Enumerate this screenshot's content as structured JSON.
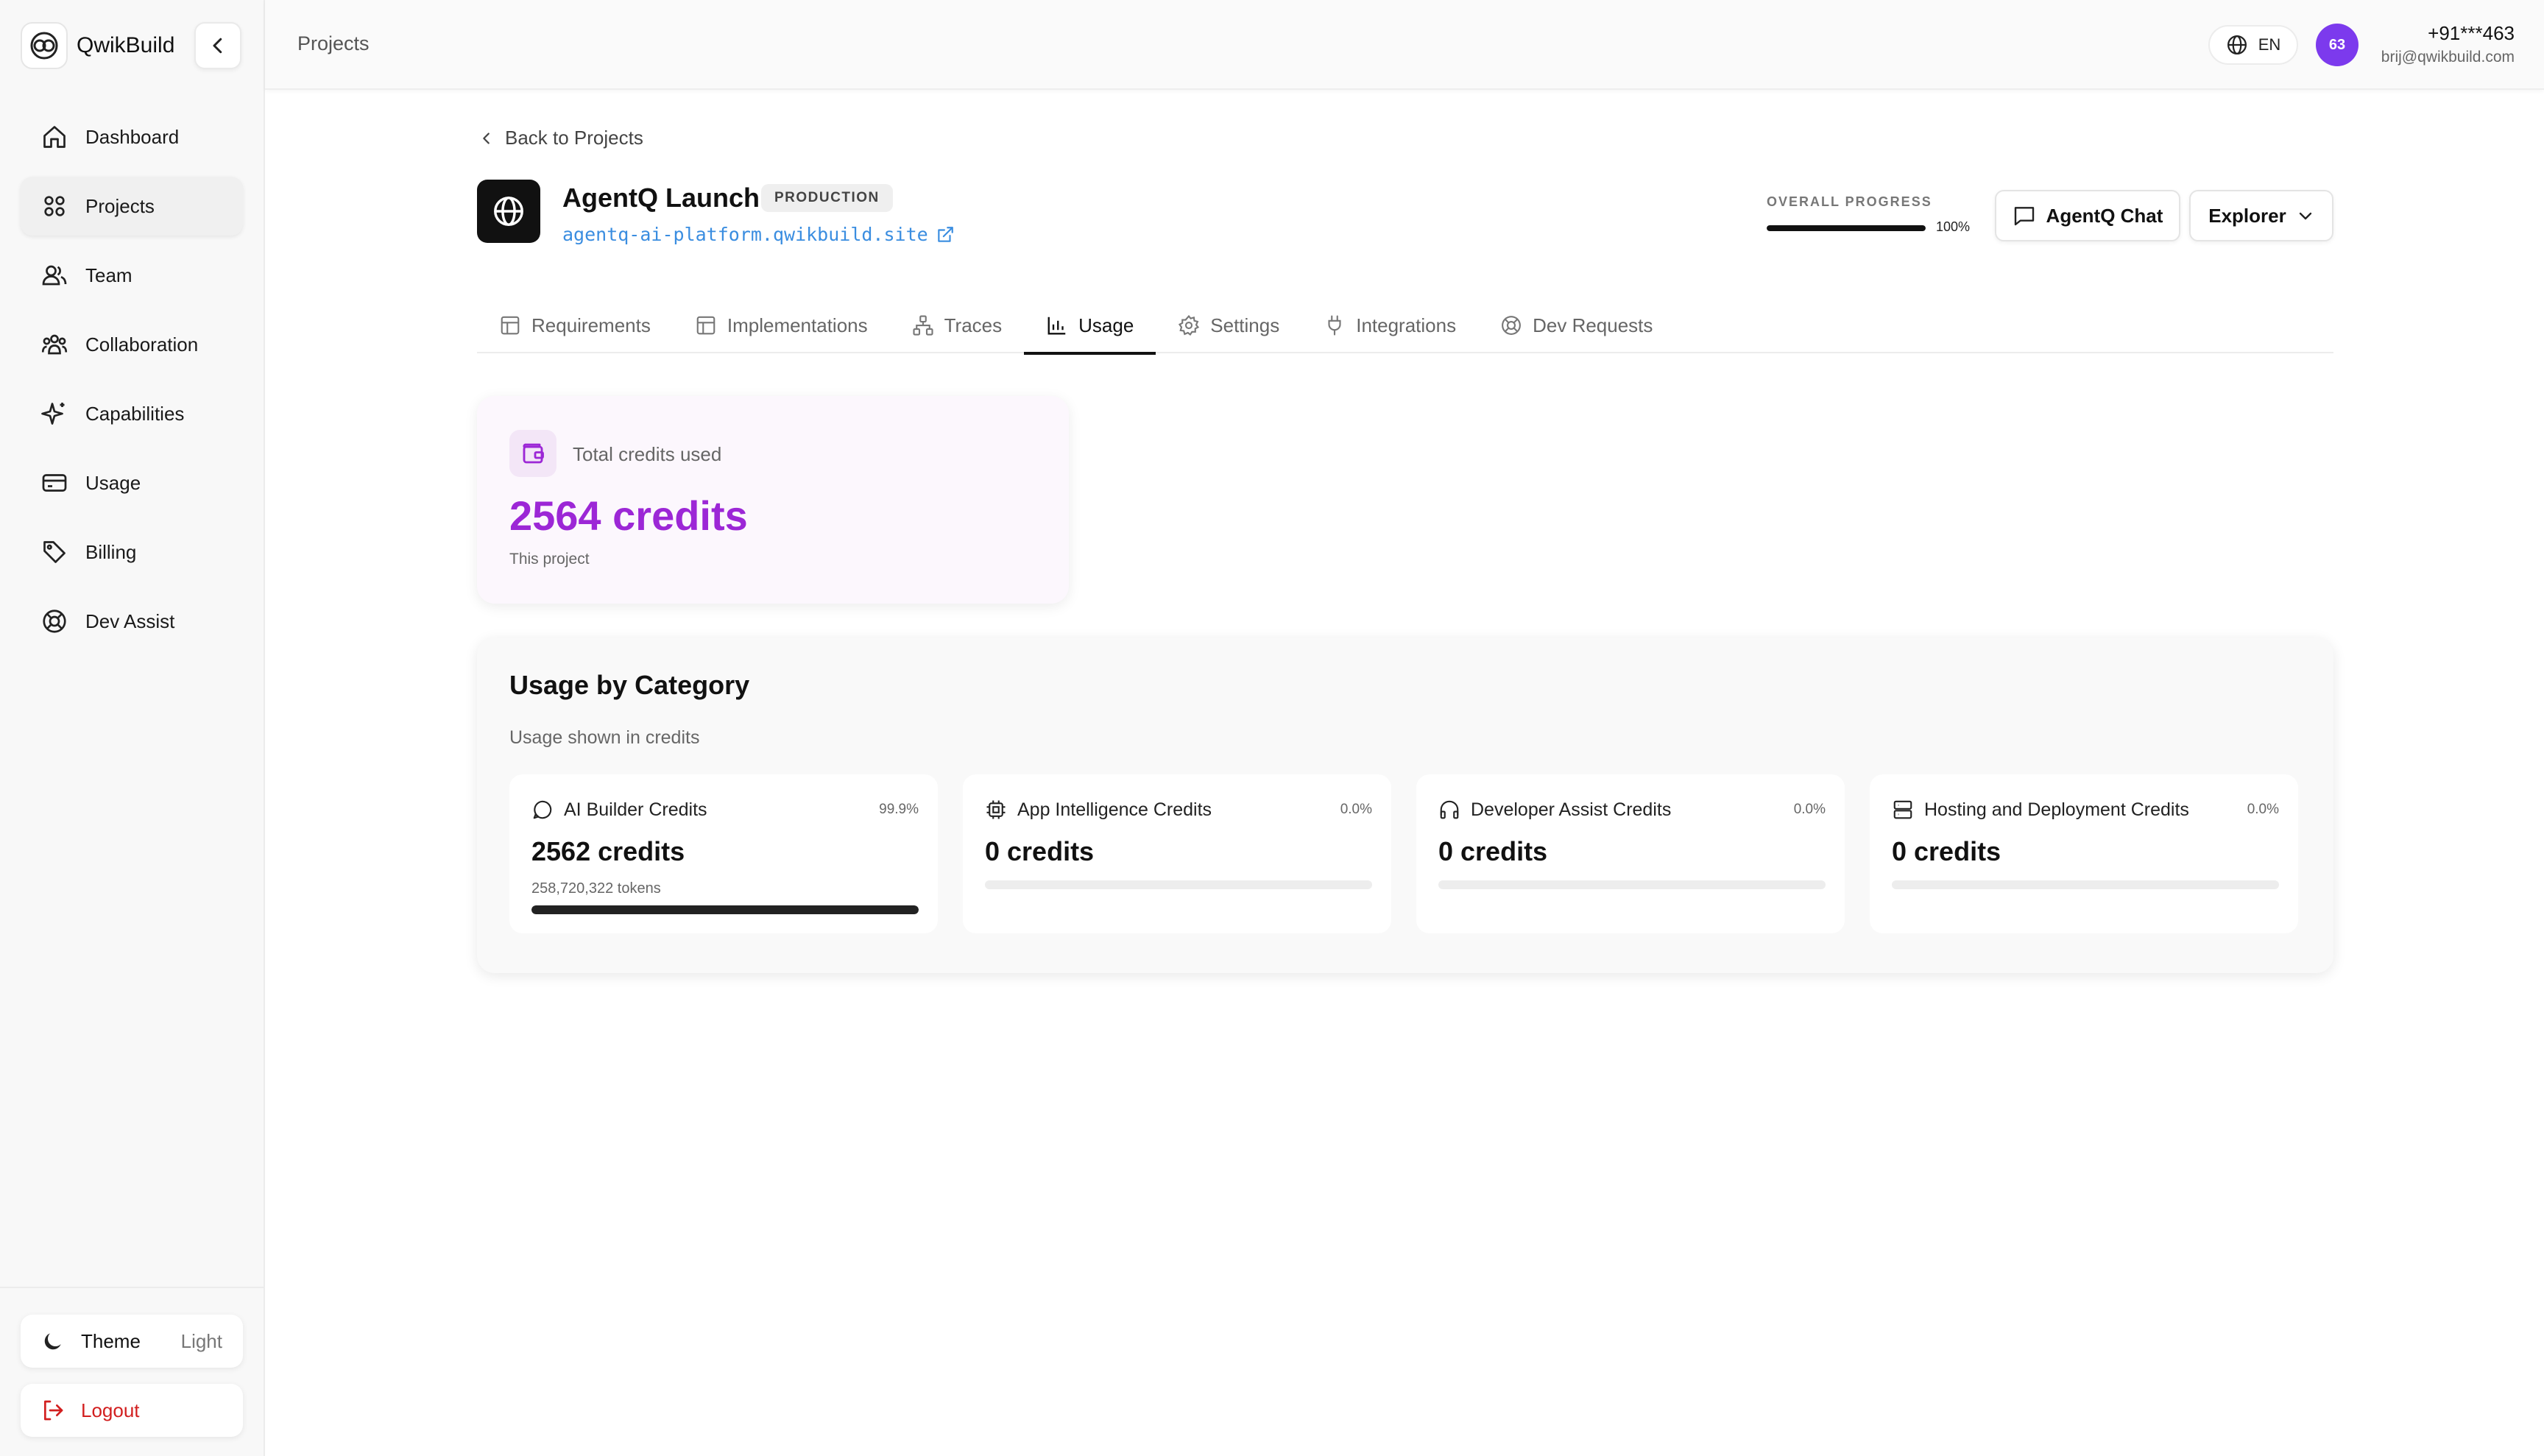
{
  "app": {
    "name": "QwikBuild"
  },
  "sidebar": {
    "items": [
      {
        "label": "Dashboard",
        "icon": "home-icon"
      },
      {
        "label": "Projects",
        "icon": "grid-icon"
      },
      {
        "label": "Team",
        "icon": "users-icon"
      },
      {
        "label": "Collaboration",
        "icon": "group-icon"
      },
      {
        "label": "Capabilities",
        "icon": "sparkles-icon"
      },
      {
        "label": "Usage",
        "icon": "credit-card-icon"
      },
      {
        "label": "Billing",
        "icon": "tag-icon"
      },
      {
        "label": "Dev Assist",
        "icon": "lifebuoy-icon"
      }
    ],
    "theme_label": "Theme",
    "theme_value": "Light",
    "logout_label": "Logout"
  },
  "topbar": {
    "breadcrumb": "Projects",
    "language": "EN",
    "avatar_text": "63",
    "user_phone": "+91***463",
    "user_email": "brij@qwikbuild.com"
  },
  "project": {
    "back_label": "Back to Projects",
    "title": "AgentQ Launch",
    "badge": "PRODUCTION",
    "url": "agentq-ai-platform.qwikbuild.site",
    "progress_label": "OVERALL PROGRESS",
    "progress_text": "100%",
    "progress_value": 1.0,
    "chat_label": "AgentQ Chat",
    "explorer_label": "Explorer"
  },
  "tabs": [
    {
      "label": "Requirements",
      "icon": "layout-icon"
    },
    {
      "label": "Implementations",
      "icon": "layout-icon"
    },
    {
      "label": "Traces",
      "icon": "network-icon"
    },
    {
      "label": "Usage",
      "icon": "bar-chart-icon"
    },
    {
      "label": "Settings",
      "icon": "gear-icon"
    },
    {
      "label": "Integrations",
      "icon": "plug-icon"
    },
    {
      "label": "Dev Requests",
      "icon": "lifebuoy-icon"
    }
  ],
  "credits": {
    "label": "Total credits used",
    "value": "2564 credits",
    "sub": "This project",
    "accent": "#9c27d6"
  },
  "usage": {
    "title": "Usage by Category",
    "subtitle": "Usage shown in credits",
    "categories": [
      {
        "name": "AI Builder Credits",
        "pct": "99.9%",
        "value": "2562 credits",
        "tokens": "258,720,322 tokens",
        "fill": 1.0,
        "icon": "chat-bubble-icon"
      },
      {
        "name": "App Intelligence Credits",
        "pct": "0.0%",
        "value": "0 credits",
        "tokens": "",
        "fill": 0.0,
        "icon": "cpu-icon"
      },
      {
        "name": "Developer Assist Credits",
        "pct": "0.0%",
        "value": "0 credits",
        "tokens": "",
        "fill": 0.0,
        "icon": "headphones-icon"
      },
      {
        "name": "Hosting and Deployment Credits",
        "pct": "0.0%",
        "value": "0 credits",
        "tokens": "",
        "fill": 0.0,
        "icon": "server-icon"
      }
    ]
  }
}
